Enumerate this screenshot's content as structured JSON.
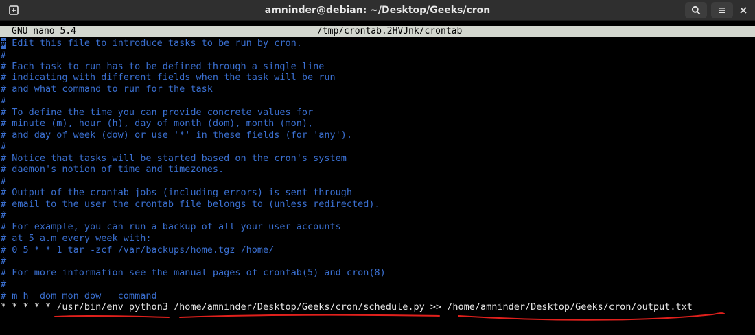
{
  "window": {
    "title": "amninder@debian: ~/Desktop/Geeks/cron"
  },
  "nano": {
    "version": "GNU nano 5.4",
    "filename": "/tmp/crontab.2HVJnk/crontab"
  },
  "file_lines": [
    "# Edit this file to introduce tasks to be run by cron.",
    "#",
    "# Each task to run has to be defined through a single line",
    "# indicating with different fields when the task will be run",
    "# and what command to run for the task",
    "#",
    "# To define the time you can provide concrete values for",
    "# minute (m), hour (h), day of month (dom), month (mon),",
    "# and day of week (dow) or use '*' in these fields (for 'any').",
    "#",
    "# Notice that tasks will be started based on the cron's system",
    "# daemon's notion of time and timezones.",
    "#",
    "# Output of the crontab jobs (including errors) is sent through",
    "# email to the user the crontab file belongs to (unless redirected).",
    "#",
    "# For example, you can run a backup of all your user accounts",
    "# at 5 a.m every week with:",
    "# 0 5 * * 1 tar -zcf /var/backups/home.tgz /home/",
    "#",
    "# For more information see the manual pages of crontab(5) and cron(8)",
    "#",
    "# m h  dom mon dow   command"
  ],
  "cron_entry": "* * * * * /usr/bin/env python3 /home/amninder/Desktop/Geeks/cron/schedule.py >> /home/amninder/Desktop/Geeks/cron/output.txt",
  "colors": {
    "comment": "#3a6fd0",
    "annotation": "#e0201c",
    "titlebar": "#2f2f2f",
    "nano_bar": "#d3d7cf"
  },
  "icons": {
    "new_tab": "new-tab-icon",
    "search": "search-icon",
    "menu": "hamburger-menu-icon",
    "close": "close-icon"
  }
}
